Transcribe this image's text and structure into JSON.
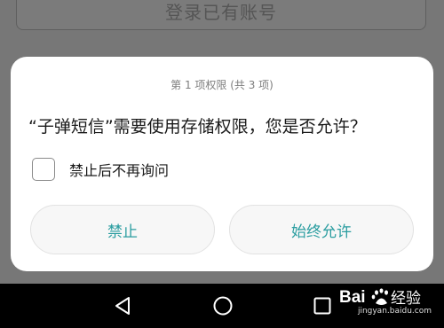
{
  "background_page": {
    "button_label": "登录已有账号"
  },
  "dialog": {
    "counter": "第 1 项权限 (共 3 项)",
    "message": "“子弹短信”需要使用存储权限，您是否允许？",
    "dont_ask_label": "禁止后不再询问",
    "dont_ask_checked": false,
    "deny_label": "禁止",
    "allow_label": "始终允许",
    "accent_color": "#2a9da0"
  },
  "navbar": {
    "back_icon": "triangle-back-icon",
    "home_icon": "circle-home-icon",
    "recent_icon": "square-recent-apps-icon"
  },
  "watermark": {
    "logo_text": "Baidu经验",
    "url": "jingyan.baidu.com"
  }
}
